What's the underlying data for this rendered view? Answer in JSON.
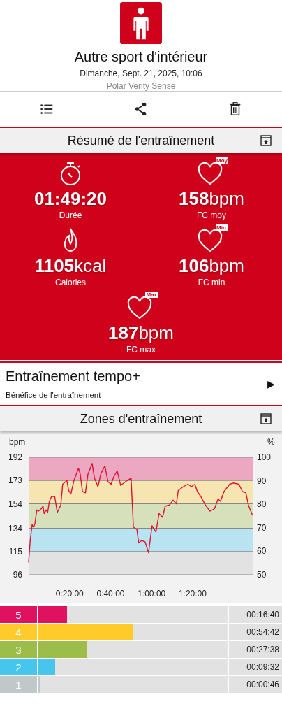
{
  "header": {
    "title": "Autre sport d'intérieur",
    "date": "Dimanche, Sept. 21, 2025, 10:06",
    "device": "Polar Verity Sense"
  },
  "toolbar": [
    {
      "kind": "list"
    },
    {
      "kind": "share"
    },
    {
      "kind": "delete"
    }
  ],
  "summary": {
    "title": "Résumé de l'entraînement",
    "items": [
      {
        "kind": "duration",
        "value": "01:49:20",
        "label": "Durée"
      },
      {
        "kind": "heart",
        "value": "158",
        "unit": "bpm",
        "label": "FC moy",
        "badge": "Moy"
      },
      {
        "kind": "calories",
        "value": "1105",
        "unit": "kcal",
        "label": "Calories"
      },
      {
        "kind": "heart",
        "value": "106",
        "unit": "bpm",
        "label": "FC min",
        "badge": "Min."
      },
      {
        "kind": "heart",
        "value": "187",
        "unit": "bpm",
        "label": "FC max",
        "badge": "Max"
      }
    ]
  },
  "benefit": {
    "title": "Entraînement tempo+",
    "subtitle": "Bénéfice de l'entraînement",
    "arrow": "▶"
  },
  "zones_section": {
    "title": "Zones d'entraînement",
    "chart_data": {
      "type": "line",
      "ylabel": "bpm",
      "y2label": "%",
      "xlim": [
        0,
        109.3
      ],
      "ylim": [
        96,
        192
      ],
      "yticks": [
        96,
        115,
        134,
        154,
        173,
        192
      ],
      "y2lim": [
        50,
        100
      ],
      "y2ticks": [
        50,
        60,
        70,
        80,
        90,
        100
      ],
      "grid": true,
      "bands": [
        {
          "axis": "y",
          "from": 173,
          "to": 192,
          "color": "#eca8c1"
        },
        {
          "axis": "y",
          "from": 154,
          "to": 173,
          "color": "#f6e5b0"
        },
        {
          "axis": "y",
          "from": 134,
          "to": 154,
          "color": "#d6e1bb"
        },
        {
          "axis": "y",
          "from": 115,
          "to": 134,
          "color": "#b9e3f0"
        },
        {
          "axis": "y",
          "from": 96,
          "to": 115,
          "color": "#e2e2e2"
        }
      ],
      "xticks": [
        {
          "value": 20,
          "label": "0:20:00"
        },
        {
          "value": 40,
          "label": "0:40:00"
        },
        {
          "value": 60,
          "label": "1:00:00"
        },
        {
          "value": 80,
          "label": "1:20:00"
        }
      ],
      "x": [
        0,
        0.8,
        1.7,
        2.5,
        3.1,
        4.0,
        4.8,
        6.2,
        7.0,
        7.6,
        8.5,
        9.3,
        10.1,
        11.2,
        12.7,
        14.0,
        15.7,
        16.6,
        18.7,
        19.5,
        20.6,
        22.1,
        24.3,
        25.1,
        26.3,
        27.7,
        28.9,
        31.0,
        32.1,
        33.8,
        35.3,
        37.2,
        38.7,
        40.2,
        41.5,
        43.2,
        44.9,
        47.2,
        50.0,
        51.1,
        52.8,
        53.7,
        55.1,
        56.8,
        58.5,
        60.2,
        62.1,
        63.6,
        65.3,
        66.6,
        68.7,
        70.4,
        72.1,
        73.0,
        75.5,
        77.7,
        79.4,
        81.1,
        82.3,
        84.0,
        86.2,
        88.5,
        90.7,
        92.4,
        93.6,
        95.3,
        98.1,
        99.8,
        102.6,
        104.3,
        106.0,
        107.2,
        109.1
      ],
      "values": [
        106,
        124,
        137,
        135,
        138,
        149,
        148,
        150,
        152,
        146,
        149,
        147,
        156,
        160,
        160,
        147,
        153,
        170,
        173,
        165,
        162,
        173,
        183,
        179,
        164,
        163,
        178,
        187,
        175,
        168,
        179,
        185,
        172,
        170,
        176,
        181,
        169,
        172,
        175,
        135,
        133,
        122,
        124,
        123,
        114,
        136,
        131,
        146,
        143,
        152,
        153,
        157,
        154,
        165,
        168,
        170,
        168,
        170,
        164,
        160,
        153,
        148,
        150,
        158,
        156,
        164,
        170,
        171,
        170,
        164,
        163,
        153,
        145
      ]
    },
    "zones": [
      {
        "label": "5",
        "color": "#e0115f",
        "level": 0.152,
        "time": "00:16:40"
      },
      {
        "label": "4",
        "color": "#ffcb2b",
        "level": 0.5,
        "time": "00:54:42"
      },
      {
        "label": "3",
        "color": "#9cbd4a",
        "level": 0.253,
        "time": "00:27:38"
      },
      {
        "label": "2",
        "color": "#46c6ec",
        "level": 0.087,
        "time": "00:09:32"
      },
      {
        "label": "1",
        "color": "#c1c9c8",
        "level": 0.007,
        "time": "00:00:46"
      }
    ]
  }
}
